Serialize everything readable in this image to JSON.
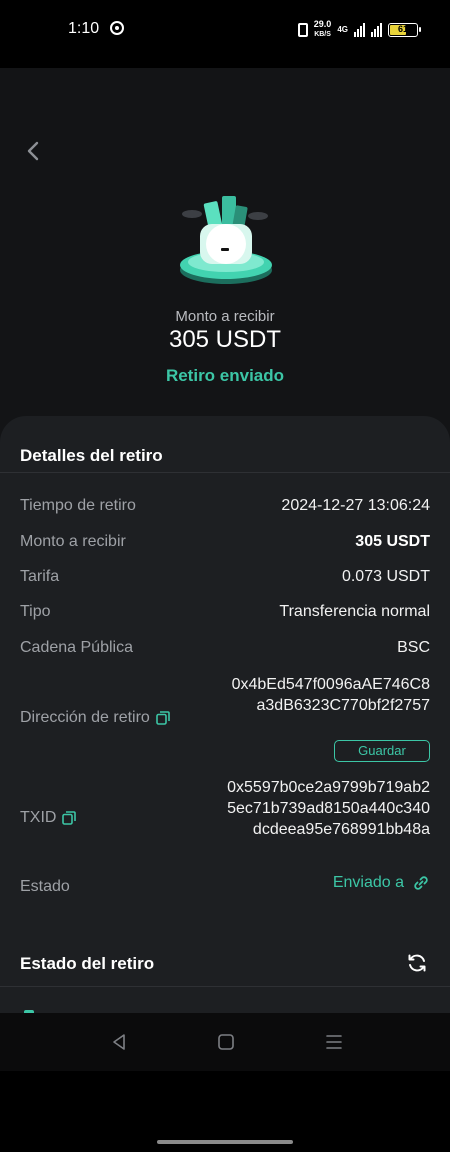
{
  "status_bar": {
    "time": "1:10",
    "speed_value": "29.0",
    "speed_unit": "KB/S",
    "network": "4G",
    "battery": "61"
  },
  "hero": {
    "amount_label": "Monto a recibir",
    "amount_value": "305 USDT",
    "status": "Retiro enviado"
  },
  "details": {
    "title": "Detalles del retiro",
    "rows": [
      {
        "label": "Tiempo de retiro",
        "value": "2024-12-27 13:06:24"
      },
      {
        "label": "Monto a recibir",
        "value": "305 USDT"
      },
      {
        "label": "Tarifa",
        "value": "0.073 USDT"
      },
      {
        "label": "Tipo",
        "value": "Transferencia normal"
      },
      {
        "label": "Cadena Pública",
        "value": "BSC"
      },
      {
        "label": "Dirección de retiro",
        "value": "0x4bEd547f0096aAE746C8a3dB6323C770bf2f2757"
      },
      {
        "label": "TXID",
        "value": "0x5597b0ce2a9799b719ab25ec71b739ad8150a440c340dcdeea95e768991bb48a"
      },
      {
        "label": "Estado",
        "value": "Enviado a"
      }
    ],
    "save_button": "Guardar"
  },
  "withdraw_status": {
    "title": "Estado del retiro"
  },
  "colors": {
    "accent": "#3cc6a6",
    "background": "#131416",
    "card": "#1d1f22"
  },
  "icons": [
    "back-arrow-icon",
    "wallet-success-icon",
    "copy-icon",
    "link-icon",
    "refresh-icon",
    "nav-back-icon",
    "nav-home-icon",
    "nav-menu-icon"
  ]
}
